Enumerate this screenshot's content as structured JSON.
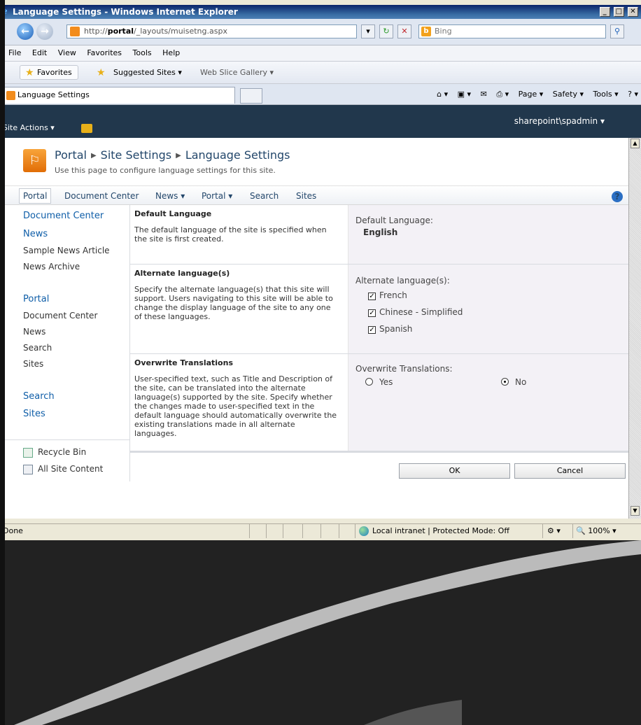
{
  "window": {
    "title": "Language Settings - Windows Internet Explorer",
    "min": "_",
    "max": "□",
    "close": "✕"
  },
  "address": {
    "url_prefix": "http://",
    "url_host": "portal",
    "url_path": "/_layouts/muisetng.aspx",
    "search_placeholder": "Bing",
    "refresh": "↻",
    "stop": "✕",
    "search_go": "⚲"
  },
  "menu": [
    "File",
    "Edit",
    "View",
    "Favorites",
    "Tools",
    "Help"
  ],
  "favorites_bar": {
    "favorites_label": "Favorites",
    "suggested_sites": "Suggested Sites ▾",
    "web_slice": "Web Slice Gallery ▾"
  },
  "tabs": {
    "active_tab": "Language Settings",
    "commands": [
      "Page ▾",
      "Safety ▾",
      "Tools ▾",
      "? ▾"
    ]
  },
  "sharepoint": {
    "site_actions": "Site Actions ▾",
    "user": "sharepoint\\spadmin ▾"
  },
  "header": {
    "crumb_1": "Portal",
    "crumb_2": "Site Settings",
    "crumb_3": "Language Settings",
    "description": "Use this page to configure language settings for this site."
  },
  "topnav": {
    "items": [
      "Portal",
      "Document Center",
      "News ▾",
      "Portal ▾",
      "Search",
      "Sites"
    ],
    "help": "?"
  },
  "leftnav": {
    "group1": [
      "Document Center",
      "News",
      "Sample News Article",
      "News Archive"
    ],
    "group2": [
      "Portal",
      "Document Center",
      "News",
      "Search",
      "Sites"
    ],
    "group3": [
      "Search",
      "Sites"
    ],
    "recycle_bin": "Recycle Bin",
    "all_site_content": "All Site Content"
  },
  "sections": {
    "default_language": {
      "title": "Default Language",
      "description": "The default language of the site is specified when the site is first created.",
      "control_label": "Default Language:",
      "value": "English"
    },
    "alternate": {
      "title": "Alternate language(s)",
      "description": "Specify the alternate language(s) that this site will support. Users navigating to this site will be able to change the display language of the site to any one of these languages.",
      "control_label": "Alternate language(s):",
      "languages": [
        {
          "name": "French",
          "checked": true
        },
        {
          "name": "Chinese - Simplified",
          "checked": true
        },
        {
          "name": "Spanish",
          "checked": true
        }
      ]
    },
    "overwrite": {
      "title": "Overwrite Translations",
      "description": "User-specified text, such as Title and Description of the site, can be translated into the alternate language(s) supported by the site. Specify whether the changes made to user-specified text in the default language should automatically overwrite the existing translations made in all alternate languages.",
      "control_label": "Overwrite Translations:",
      "option_yes": "Yes",
      "option_no": "No",
      "selected": "No"
    }
  },
  "buttons": {
    "ok": "OK",
    "cancel": "Cancel"
  },
  "statusbar": {
    "status": "Done",
    "zone": "Local intranet | Protected Mode: Off",
    "zoom": "100%"
  }
}
